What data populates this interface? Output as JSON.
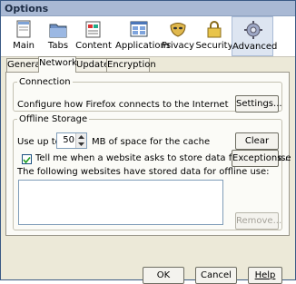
{
  "window": {
    "title": "Options"
  },
  "toolbar": {
    "items": [
      {
        "label": "Main",
        "icon": "window-icon"
      },
      {
        "label": "Tabs",
        "icon": "tabs-folder-icon"
      },
      {
        "label": "Content",
        "icon": "content-page-icon"
      },
      {
        "label": "Applications",
        "icon": "applications-icon"
      },
      {
        "label": "Privacy",
        "icon": "mask-icon"
      },
      {
        "label": "Security",
        "icon": "lock-icon"
      },
      {
        "label": "Advanced",
        "icon": "gear-icon"
      }
    ],
    "selected": "Advanced"
  },
  "tabs": [
    "General",
    "Network",
    "Update",
    "Encryption"
  ],
  "active_tab": "Network",
  "connection": {
    "legend": "Connection",
    "description": "Configure how Firefox connects to the Internet",
    "settings_button": "Settings..."
  },
  "offline": {
    "legend": "Offline Storage",
    "use_up_to": "Use up to",
    "cache_value": "50",
    "cache_suffix": "MB of space for the cache",
    "clear_button": "Clear Now",
    "tell_me_label": "Tell me when a website asks to store data for offline use",
    "tell_me_checked": true,
    "exceptions_button": "Exceptions...",
    "sites_label": "The following websites have stored data for offline use:",
    "remove_button": "Remove..."
  },
  "footer": {
    "ok": "OK",
    "cancel": "Cancel",
    "help": "Help"
  }
}
